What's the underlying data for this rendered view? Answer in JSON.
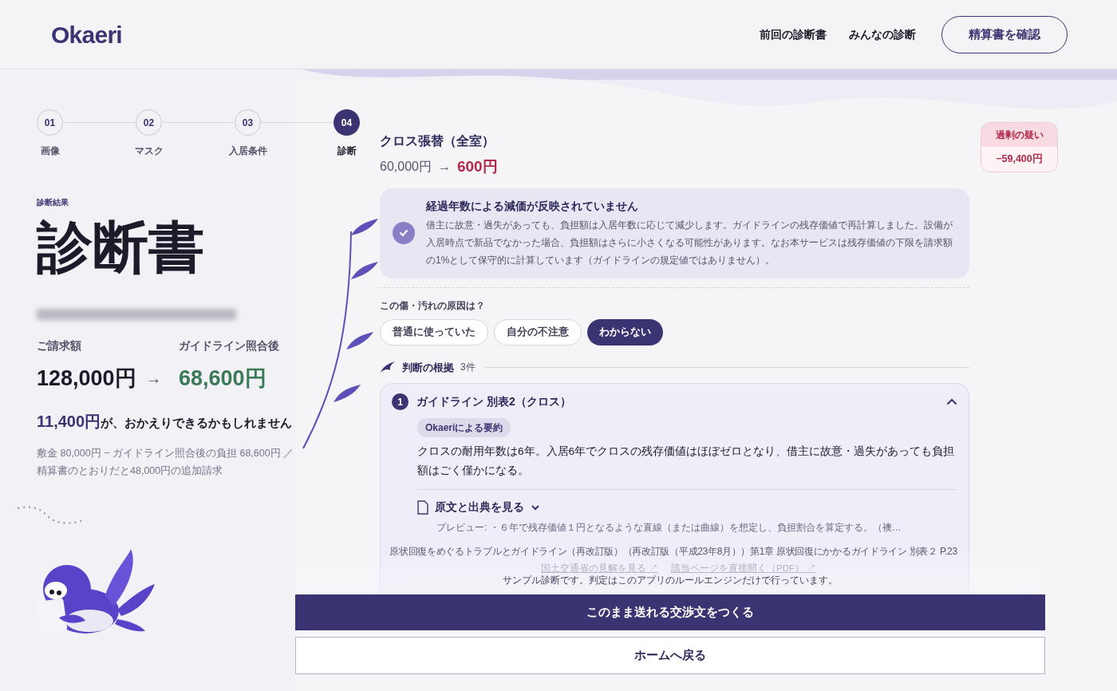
{
  "header": {
    "logo": "Okaeri",
    "nav": [
      "前回の診断書",
      "みんなの診断"
    ],
    "button": "精算書を確認"
  },
  "steps": [
    {
      "number": "01",
      "label": "画像",
      "selected": false
    },
    {
      "number": "02",
      "label": "マスク",
      "selected": false
    },
    {
      "number": "03",
      "label": "入居条件",
      "selected": false
    },
    {
      "number": "04",
      "label": "診断",
      "selected": true
    }
  ],
  "result": {
    "eyebrow": "診断結果",
    "title": "診断書",
    "billed_label": "ご請求額",
    "guideline_label": "ガイドライン照合後",
    "billed": "128,000円",
    "arrow": "→",
    "guideline": "68,600円",
    "refund": "11,400円",
    "refund_text": "が、おかえりできるかもしれません",
    "note": "敷金 80,000円 − ガイドライン照合後の負担 68,600円 ／精算書のとおりだと48,000円の追加請求"
  },
  "item": {
    "title": "クロス張替（全室）",
    "original": "60,000円",
    "arrow": "→",
    "adjusted": "600円",
    "badge_label": "過剰の疑い",
    "badge_amount": "−59,400円"
  },
  "alert": {
    "checked": true,
    "title": "経過年数による減価が反映されていません",
    "body": "借主に故意・過失があっても、負担額は入居年数に応じて減少します。ガイドラインの残存価値で再計算しました。設備が入居時点で新品でなかった場合、負担額はさらに小さくなる可能性があります。なお本サービスは残存価値の下限を請求額の1%として保守的に計算しています（ガイドラインの規定値ではありません）。"
  },
  "question": {
    "label": "この傷・汚れの原因は？",
    "options": [
      {
        "label": "普通に使っていた",
        "selected": false
      },
      {
        "label": "自分の不注意",
        "selected": false
      },
      {
        "label": "わからない",
        "selected": true
      }
    ]
  },
  "evidence": {
    "title": "判断の根拠",
    "count": "3件",
    "items": [
      {
        "number": "1",
        "title": "ガイドライン 別表2（クロス）",
        "expanded": true,
        "summary_tag": "Okaeriによる要約",
        "summary": "クロスの耐用年数は6年。入居6年でクロスの残存価値はほぼゼロとなり、借主に故意・過失があっても負担額はごく僅かになる。",
        "source_toggle": "原文と出典を見る",
        "preview": "プレビュー: ・６年で残存価値１円となるような直線（または曲線）を想定し、負担割合を算定する。（襖…",
        "citation": "原状回復をめぐるトラブルとガイドライン（再改訂版）（再改訂版（平成23年8月））第1章 原状回復にかかるガイドライン 別表２ P.23",
        "links": [
          "国土交通省の見解を見る ↗",
          "該当ページを直接開く（PDF） ↗"
        ]
      }
    ]
  },
  "footer": {
    "note": "サンプル診断です。判定はこのアプリのルールエンジンだけで行っています。",
    "primary": "このまま送れる交渉文をつくる",
    "secondary": "ホームへ戻る"
  }
}
